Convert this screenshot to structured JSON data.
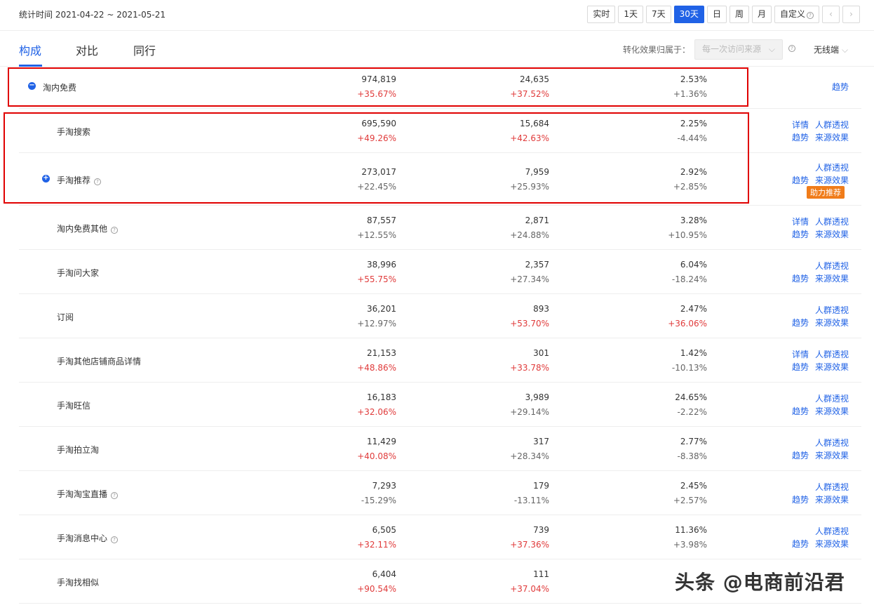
{
  "header": {
    "stat_time": "统计时间 2021-04-22 ~ 2021-05-21",
    "periods": [
      "实时",
      "1天",
      "7天",
      "30天",
      "日",
      "周",
      "月",
      "自定义"
    ],
    "active_period": "30天",
    "prev": "‹",
    "next": "›"
  },
  "tabs": {
    "composition": "构成",
    "compare": "对比",
    "peer": "同行"
  },
  "attribution": {
    "label": "转化效果归属于：",
    "value": "每一次访问来源",
    "device": "无线端"
  },
  "actions": {
    "detail": "详情",
    "audience": "人群透视",
    "trend": "趋势",
    "source_effect": "来源效果",
    "boost": "助力推荐"
  },
  "rows": [
    {
      "name": "淘内免费",
      "v1": "974,819",
      "c1": "+35.67%",
      "v2": "24,635",
      "c2": "+37.52%",
      "v3": "2.53%",
      "c3": "+1.36%"
    },
    {
      "name": "手淘搜索",
      "v1": "695,590",
      "c1": "+49.26%",
      "v2": "15,684",
      "c2": "+42.63%",
      "v3": "2.25%",
      "c3": "-4.44%"
    },
    {
      "name": "手淘推荐",
      "v1": "273,017",
      "c1": "+22.45%",
      "v2": "7,959",
      "c2": "+25.93%",
      "v3": "2.92%",
      "c3": "+2.85%"
    },
    {
      "name": "淘内免费其他",
      "v1": "87,557",
      "c1": "+12.55%",
      "v2": "2,871",
      "c2": "+24.88%",
      "v3": "3.28%",
      "c3": "+10.95%"
    },
    {
      "name": "手淘问大家",
      "v1": "38,996",
      "c1": "+55.75%",
      "v2": "2,357",
      "c2": "+27.34%",
      "v3": "6.04%",
      "c3": "-18.24%"
    },
    {
      "name": "订阅",
      "v1": "36,201",
      "c1": "+12.97%",
      "v2": "893",
      "c2": "+53.70%",
      "v3": "2.47%",
      "c3": "+36.06%"
    },
    {
      "name": "手淘其他店铺商品详情",
      "v1": "21,153",
      "c1": "+48.86%",
      "v2": "301",
      "c2": "+33.78%",
      "v3": "1.42%",
      "c3": "-10.13%"
    },
    {
      "name": "手淘旺信",
      "v1": "16,183",
      "c1": "+32.06%",
      "v2": "3,989",
      "c2": "+29.14%",
      "v3": "24.65%",
      "c3": "-2.22%"
    },
    {
      "name": "手淘拍立淘",
      "v1": "11,429",
      "c1": "+40.08%",
      "v2": "317",
      "c2": "+28.34%",
      "v3": "2.77%",
      "c3": "-8.38%"
    },
    {
      "name": "手淘淘宝直播",
      "v1": "7,293",
      "c1": "-15.29%",
      "v2": "179",
      "c2": "-13.11%",
      "v3": "2.45%",
      "c3": "+2.57%"
    },
    {
      "name": "手淘消息中心",
      "v1": "6,505",
      "c1": "+32.11%",
      "v2": "739",
      "c2": "+37.36%",
      "v3": "11.36%",
      "c3": "+3.98%"
    },
    {
      "name": "手淘找相似",
      "v1": "6,404",
      "c1": "+90.54%",
      "v2": "111",
      "c2": "+37.04%",
      "v3": "",
      "c3": ""
    }
  ],
  "watermark": "头条 @电商前沿君",
  "colors": {
    "accent": "#2062e6",
    "up": "#e03b3b",
    "highlight": "#e00000",
    "badge": "#f07c1a"
  }
}
